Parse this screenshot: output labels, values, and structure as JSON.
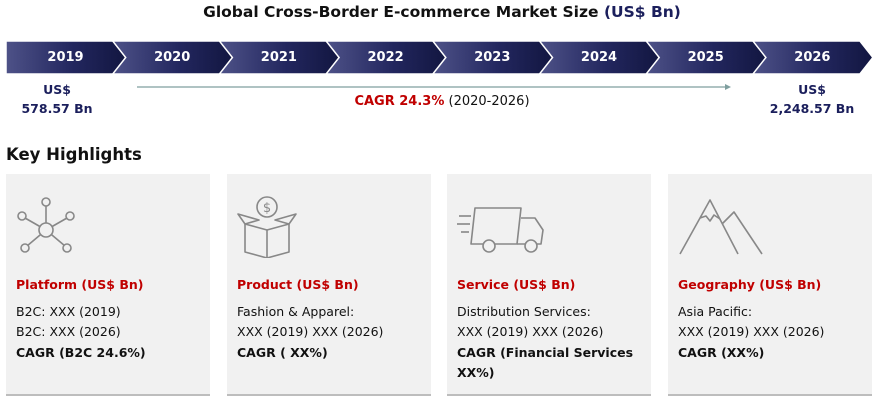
{
  "title": {
    "main": "Global Cross-Border E-commerce Market Size",
    "unit": "(US$ Bn)"
  },
  "timeline": {
    "years": [
      "2019",
      "2020",
      "2021",
      "2022",
      "2023",
      "2024",
      "2025",
      "2026"
    ]
  },
  "start_value": {
    "currency": "US$",
    "amount": "578.57 Bn"
  },
  "end_value": {
    "currency": "US$",
    "amount": "2,248.57 Bn"
  },
  "cagr": {
    "label": "CAGR 24.3%",
    "period": "(2020-2026)"
  },
  "key_highlights": {
    "title": "Key Highlights",
    "cards": [
      {
        "icon": "network-icon",
        "heading": "Platform (US$ Bn)",
        "lines": "B2C: XXX (2019)\nB2C: XXX (2026)",
        "cagr": "CAGR (B2C 24.6%)"
      },
      {
        "icon": "dollar-box-icon",
        "heading": "Product (US$ Bn)",
        "lines": "Fashion & Apparel:\nXXX (2019) XXX (2026)",
        "cagr": "CAGR ( XX%)"
      },
      {
        "icon": "delivery-truck-icon",
        "heading": "Service (US$ Bn)",
        "lines": "Distribution Services:\nXXX (2019) XXX (2026)",
        "cagr": "CAGR (Financial Services XX%)"
      },
      {
        "icon": "mountains-icon",
        "heading": "Geography (US$ Bn)",
        "lines": "Asia Pacific:\nXXX (2019) XXX (2026)",
        "cagr": "CAGR (XX%)"
      }
    ]
  },
  "colors": {
    "navy": "#1b1f5c",
    "accent_red": "#c00000",
    "card_bg": "#f1f1f1",
    "arrow": "#7f9f9f"
  }
}
